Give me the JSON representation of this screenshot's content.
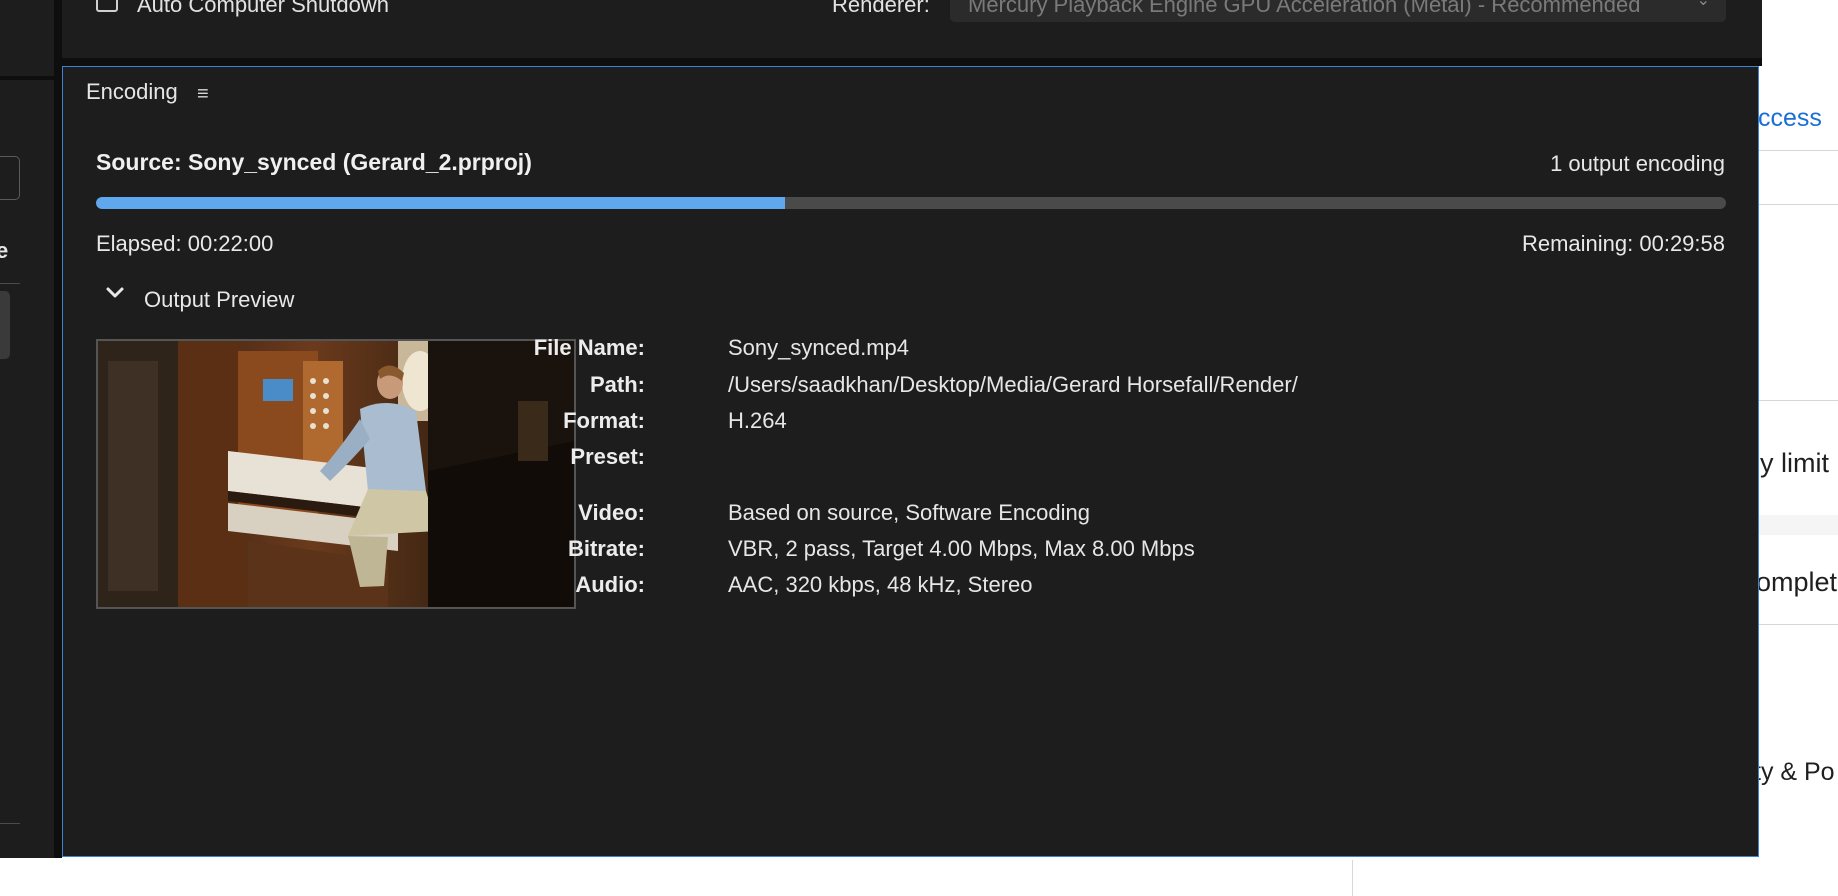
{
  "top": {
    "shutdown_label": "Auto Computer Shutdown",
    "renderer_label": "Renderer:",
    "renderer_value": "Mercury Playback Engine GPU Acceleration (Metal) - Recommended"
  },
  "encoding": {
    "tab_title": "Encoding",
    "source": "Source: Sony_synced (Gerard_2.prproj)",
    "output_count": "1 output encoding",
    "progress": 0.423,
    "elapsed": "Elapsed: 00:22:00",
    "remaining": "Remaining: 00:29:58",
    "output_preview_label": "Output Preview",
    "details": {
      "file_name_label": "File Name:",
      "file_name": "Sony_synced.mp4",
      "path_label": "Path:",
      "path": "/Users/saadkhan/Desktop/Media/Gerard Horsefall/Render/",
      "format_label": "Format:",
      "format": "H.264",
      "preset_label": "Preset:",
      "preset": "",
      "video_label": "Video:",
      "video": "Based on source, Software Encoding",
      "bitrate_label": "Bitrate:",
      "bitrate": "VBR, 2 pass, Target 4.00 Mbps, Max 8.00 Mbps",
      "audio_label": "Audio:",
      "audio": "AAC, 320 kbps, 48 kHz, Stereo"
    }
  },
  "background": {
    "left_fragment": "e",
    "right_fragments": [
      "ccess",
      "y limit",
      "omplet",
      "ty & Po"
    ]
  },
  "colors": {
    "accent": "#3d82d6",
    "progress_fill": "#5fa8ee",
    "panel_bg": "#1d1d1d"
  }
}
